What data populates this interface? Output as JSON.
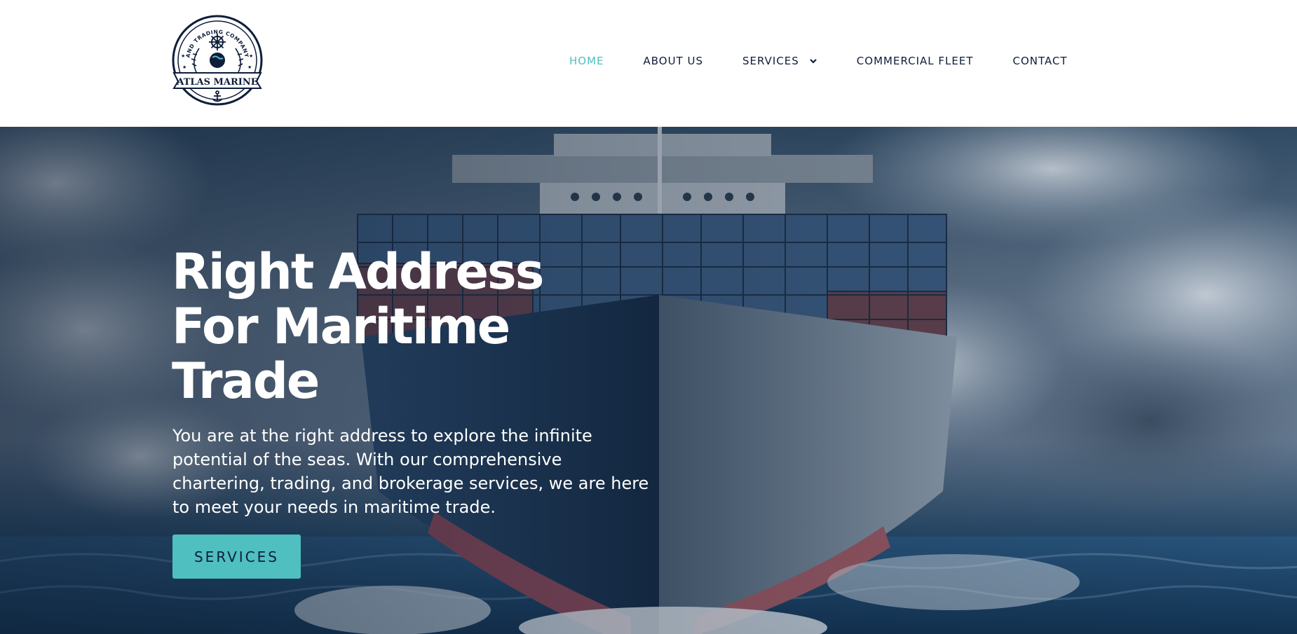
{
  "brand": {
    "logo_arc_text": "AND TRADING COMPANY",
    "logo_banner_text": "ATLAS MARINE",
    "icons": [
      "ship-wheel-icon",
      "anchor-icon",
      "laurel-icon",
      "globe-icon"
    ]
  },
  "nav": {
    "items": [
      {
        "label": "HOME",
        "active": true
      },
      {
        "label": "ABOUT US",
        "active": false
      },
      {
        "label": "SERVICES",
        "active": false,
        "has_dropdown": true
      },
      {
        "label": "COMMERCIAL FLEET",
        "active": false
      },
      {
        "label": "CONTACT",
        "active": false
      }
    ]
  },
  "hero": {
    "title_lines": [
      "Right Address",
      "For Maritime",
      "Trade"
    ],
    "text": "You are at the right address to explore the infinite potential of the seas. With our comprehensive chartering, trading, and brokerage services, we are here to meet your needs in maritime trade.",
    "button_label": "SERVICES"
  },
  "colors": {
    "accent": "#4fbfc0",
    "navy": "#0e1d3a",
    "white": "#ffffff"
  }
}
